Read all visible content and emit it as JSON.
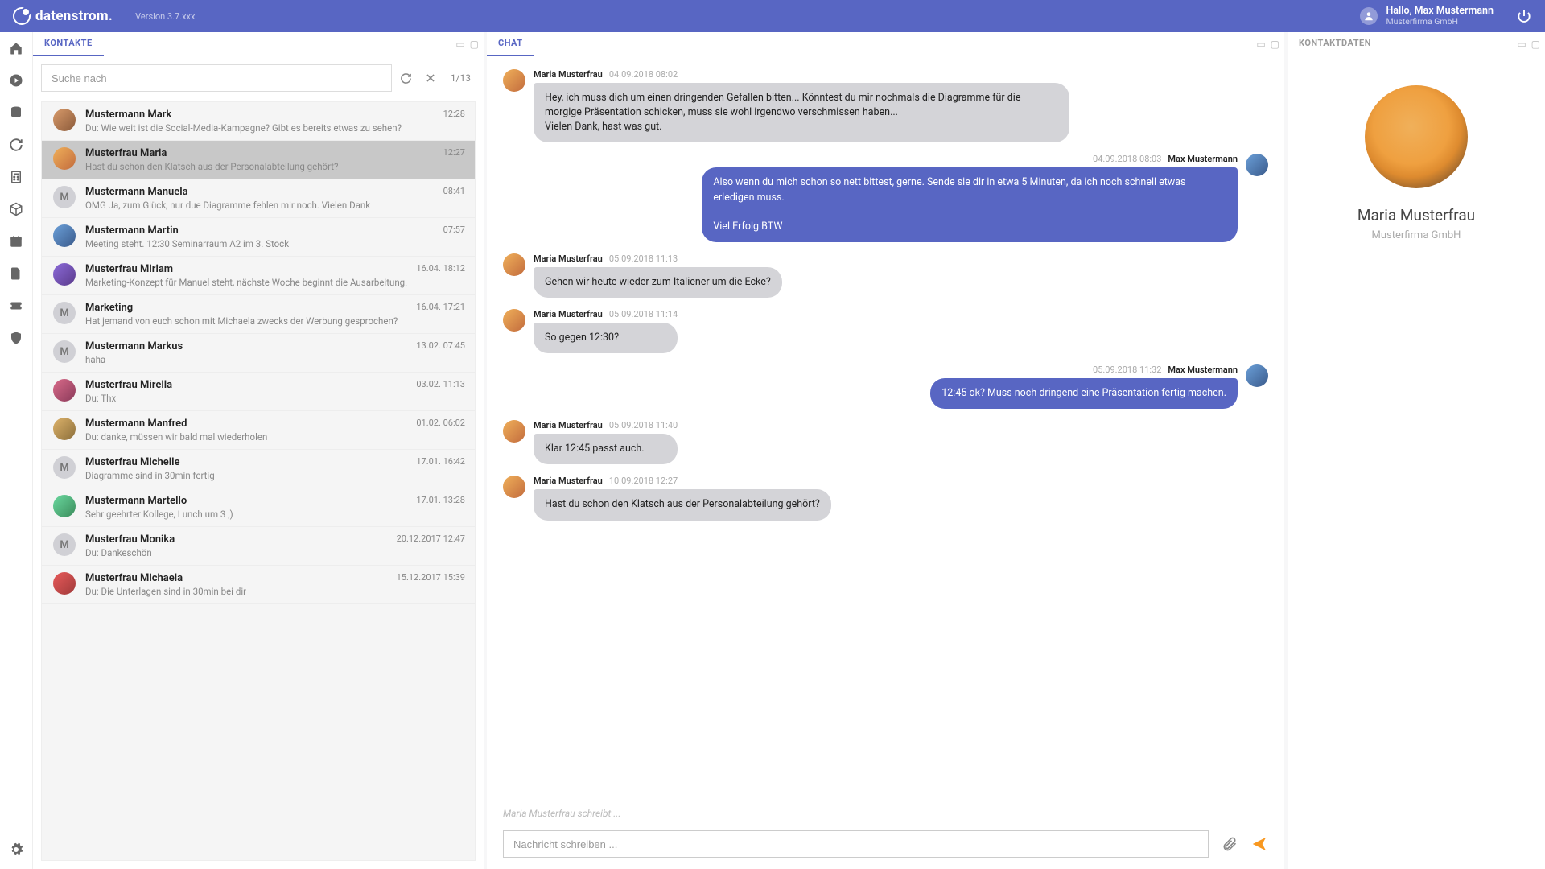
{
  "header": {
    "brand": "datenstrom.",
    "version": "Version 3.7.xxx",
    "greeting": "Hallo, Max Mustermann",
    "company": "Musterfirma GmbH"
  },
  "sidebar": {
    "icons": [
      "home",
      "play",
      "database",
      "refresh",
      "calculator",
      "cube",
      "calendar",
      "file",
      "ticket",
      "shield"
    ],
    "bottom_icon": "gear"
  },
  "contacts_panel": {
    "tab_label": "KONTAKTE",
    "search_placeholder": "Suche nach",
    "count": "1/13",
    "items": [
      {
        "name": "Mustermann Mark",
        "time": "12:28",
        "preview": "Du: Wie weit ist die Social-Media-Kampagne? Gibt es bereits etwas zu sehen?",
        "avatar": "img1",
        "initial": ""
      },
      {
        "name": "Musterfrau Maria",
        "time": "12:27",
        "preview": "Hast du schon den Klatsch aus der Personalabteilung gehört?",
        "avatar": "img2",
        "initial": "",
        "active": true
      },
      {
        "name": "Mustermann Manuela",
        "time": "08:41",
        "preview": "OMG Ja, zum Glück, nur due Diagramme fehlen mir noch. Vielen Dank",
        "avatar": "",
        "initial": "M"
      },
      {
        "name": "Mustermann Martin",
        "time": "07:57",
        "preview": "Meeting steht. 12:30 Seminarraum A2 im 3. Stock",
        "avatar": "img3",
        "initial": ""
      },
      {
        "name": "Musterfrau Miriam",
        "time": "16.04. 18:12",
        "preview": "Marketing-Konzept für Manuel steht, nächste Woche beginnt die Ausarbeitung.",
        "avatar": "img4",
        "initial": ""
      },
      {
        "name": "Marketing",
        "time": "16.04. 17:21",
        "preview": "Hat jemand von euch schon mit Michaela zwecks der Werbung gesprochen?",
        "avatar": "",
        "initial": "M"
      },
      {
        "name": "Mustermann Markus",
        "time": "13.02. 07:45",
        "preview": "haha",
        "avatar": "",
        "initial": "M"
      },
      {
        "name": "Musterfrau Mirella",
        "time": "03.02. 11:13",
        "preview": "Du: Thx",
        "avatar": "img5",
        "initial": ""
      },
      {
        "name": "Mustermann Manfred",
        "time": "01.02. 06:02",
        "preview": "Du: danke, müssen wir bald mal wiederholen",
        "avatar": "img6",
        "initial": ""
      },
      {
        "name": "Musterfrau Michelle",
        "time": "17.01. 16:42",
        "preview": "Diagramme sind in 30min fertig",
        "avatar": "",
        "initial": "M"
      },
      {
        "name": "Mustermann Martello",
        "time": "17.01. 13:28",
        "preview": "Sehr geehrter Kollege, Lunch um 3 ;)",
        "avatar": "img7",
        "initial": ""
      },
      {
        "name": "Musterfrau Monika",
        "time": "20.12.2017 12:47",
        "preview": "Du: Dankeschön",
        "avatar": "",
        "initial": "M"
      },
      {
        "name": "Musterfrau Michaela",
        "time": "15.12.2017 15:39",
        "preview": "Du: Die Unterlagen sind in 30min bei dir",
        "avatar": "img8",
        "initial": ""
      }
    ]
  },
  "chat_panel": {
    "tab_label": "CHAT",
    "typing_indicator": "Maria Musterfrau schreibt ...",
    "input_placeholder": "Nachricht schreiben ...",
    "messages": [
      {
        "side": "left",
        "name": "Maria Musterfrau",
        "ts": "04.09.2018 08:02",
        "text": "Hey, ich muss dich um einen dringenden Gefallen bitten... Könntest du mir nochmals die Diagramme für die morgige Präsentation schicken, muss sie wohl irgendwo verschmissen haben...\nVielen Dank, hast was gut.",
        "avatar": "img2"
      },
      {
        "side": "right",
        "name": "Max Mustermann",
        "ts": "04.09.2018 08:03",
        "text": "Also wenn du mich schon so nett bittest, gerne. Sende sie dir in etwa 5 Minuten, da ich noch schnell etwas erledigen muss.\n\nViel Erfolg BTW",
        "avatar": "img3"
      },
      {
        "side": "left",
        "name": "Maria Musterfrau",
        "ts": "05.09.2018 11:13",
        "text": "Gehen wir heute wieder zum Italiener um die Ecke?",
        "avatar": "img2"
      },
      {
        "side": "left",
        "name": "Maria Musterfrau",
        "ts": "05.09.2018 11:14",
        "text": "So gegen 12:30?",
        "avatar": "img2"
      },
      {
        "side": "right",
        "name": "Max Mustermann",
        "ts": "05.09.2018 11:32",
        "text": "12:45 ok? Muss noch dringend eine Präsentation fertig machen.",
        "avatar": "img3"
      },
      {
        "side": "left",
        "name": "Maria Musterfrau",
        "ts": "05.09.2018 11:40",
        "text": "Klar 12:45 passt auch.",
        "avatar": "img2"
      },
      {
        "side": "left",
        "name": "Maria Musterfrau",
        "ts": "10.09.2018 12:27",
        "text": "Hast du schon den Klatsch aus der Personalabteilung gehört?",
        "avatar": "img2"
      }
    ]
  },
  "details_panel": {
    "tab_label": "KONTAKTDATEN",
    "name": "Maria Musterfrau",
    "company": "Musterfirma GmbH"
  }
}
